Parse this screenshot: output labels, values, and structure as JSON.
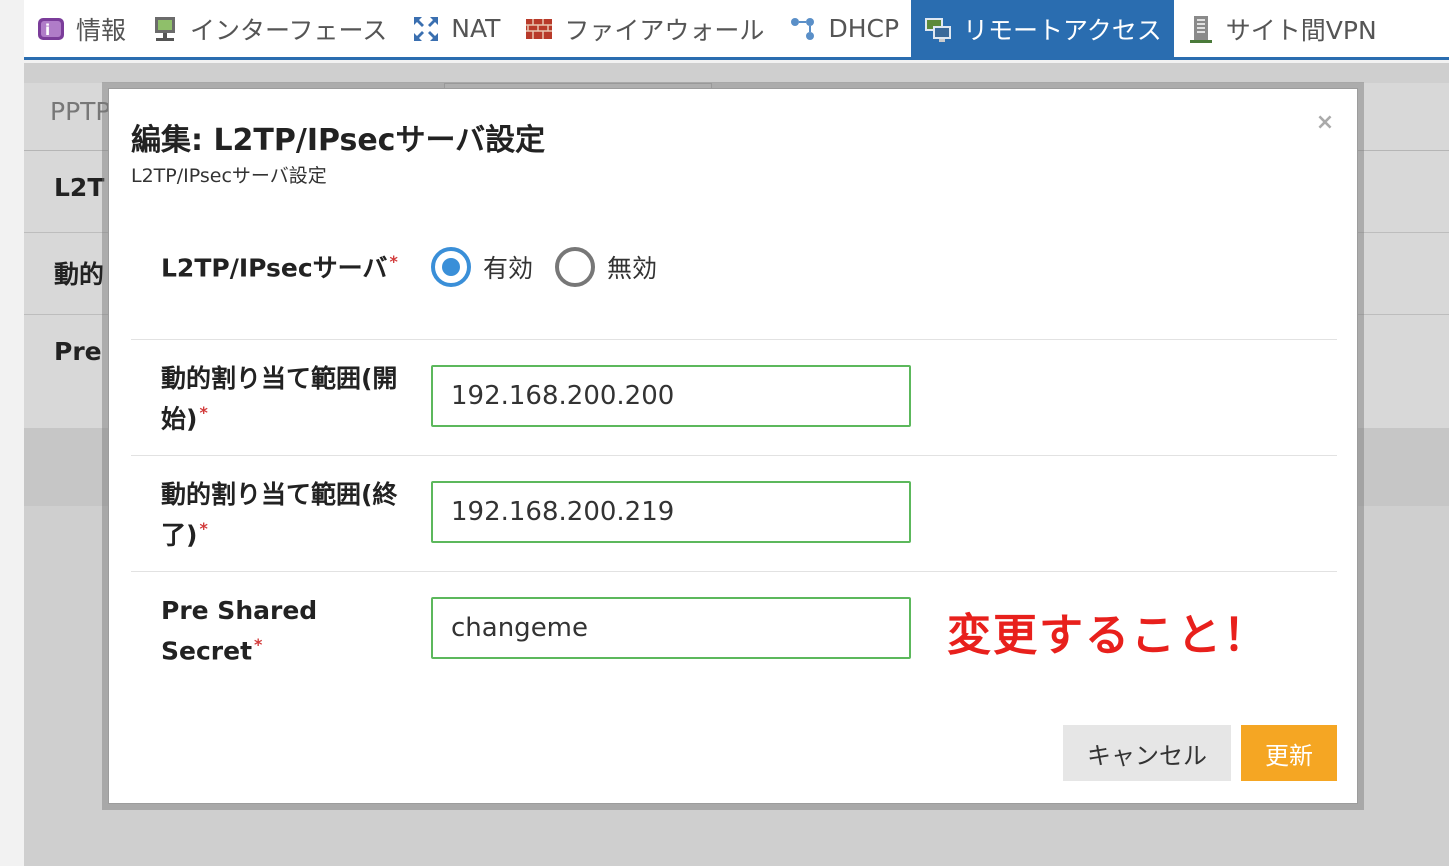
{
  "nav": {
    "tabs": [
      {
        "label": "情報",
        "icon": "info-icon",
        "active": false
      },
      {
        "label": "インターフェース",
        "icon": "network-interface-icon",
        "active": false
      },
      {
        "label": "NAT",
        "icon": "nat-arrows-icon",
        "active": false
      },
      {
        "label": "ファイアウォール",
        "icon": "firewall-icon",
        "active": false
      },
      {
        "label": "DHCP",
        "icon": "dhcp-nodes-icon",
        "active": false
      },
      {
        "label": "リモートアクセス",
        "icon": "remote-access-monitor-icon",
        "active": true
      },
      {
        "label": "サイト間VPN",
        "icon": "site-vpn-building-icon",
        "active": false
      }
    ],
    "active_color": "#2a6db0"
  },
  "background": {
    "subtab_label": "PPTP",
    "rows": [
      "L2T",
      "動的",
      "Pre"
    ]
  },
  "modal": {
    "title": "編集: L2TP/IPsecサーバ設定",
    "subtitle": "L2TP/IPsecサーバ設定",
    "close_label": "×",
    "fields": {
      "server": {
        "label": "L2TP/IPsecサーバ",
        "options": [
          "有効",
          "無効"
        ],
        "selected": "有効"
      },
      "range_start": {
        "label": "動的割り当て範囲(開始)",
        "value": "192.168.200.200"
      },
      "range_end": {
        "label": "動的割り当て範囲(終了)",
        "value": "192.168.200.219"
      },
      "psk": {
        "label": "Pre Shared Secret",
        "value": "changeme"
      }
    },
    "required_mark": "*",
    "annotation": "変更すること！",
    "buttons": {
      "cancel": "キャンセル",
      "update": "更新"
    },
    "colors": {
      "input_border": "#5cb85c",
      "radio_checked": "#3a8fd8",
      "update_button": "#f5a623",
      "annotation": "#e8201c",
      "required": "#d23a3a"
    }
  }
}
